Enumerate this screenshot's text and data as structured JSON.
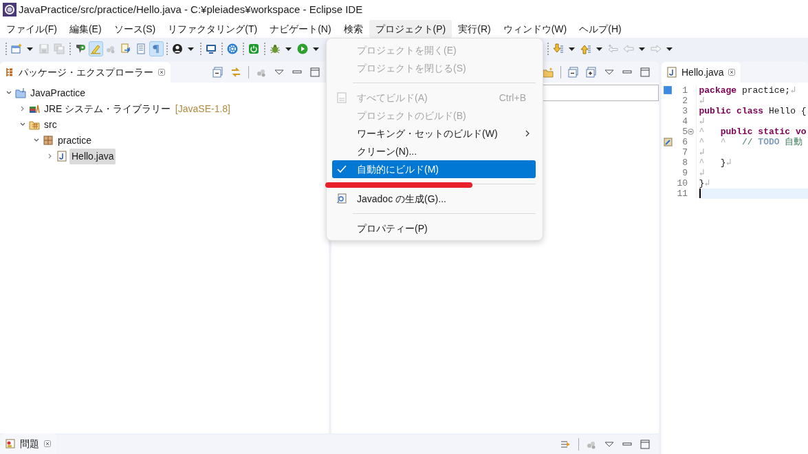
{
  "window": {
    "title": "JavaPractice/src/practice/Hello.java - C:¥pleiades¥workspace - Eclipse IDE"
  },
  "menubar": [
    {
      "label": "ファイル(F)",
      "selected": false
    },
    {
      "label": "編集(E)",
      "selected": false
    },
    {
      "label": "ソース(S)",
      "selected": false
    },
    {
      "label": "リファクタリング(T)",
      "selected": false
    },
    {
      "label": "ナビゲート(N)",
      "selected": false
    },
    {
      "label": "検索",
      "selected": false
    },
    {
      "label": "プロジェクト(P)",
      "selected": true
    },
    {
      "label": "実行(R)",
      "selected": false
    },
    {
      "label": "ウィンドウ(W)",
      "selected": false
    },
    {
      "label": "ヘルプ(H)",
      "selected": false
    }
  ],
  "toolbar_left": [
    [
      {
        "kind": "new",
        "dropdown": true,
        "pressed": false,
        "disabled": false
      },
      {
        "kind": "save",
        "dropdown": false,
        "pressed": false,
        "disabled": true
      },
      {
        "kind": "saveall",
        "dropdown": false,
        "pressed": false,
        "disabled": true
      }
    ],
    [
      {
        "kind": "opentype",
        "dropdown": false,
        "pressed": false,
        "disabled": false
      },
      {
        "kind": "highlight",
        "dropdown": false,
        "pressed": true,
        "disabled": false
      },
      {
        "kind": "beans",
        "dropdown": false,
        "pressed": false,
        "disabled": true
      },
      {
        "kind": "docarrow",
        "dropdown": false,
        "pressed": false,
        "disabled": false
      },
      {
        "kind": "doc",
        "dropdown": false,
        "pressed": false,
        "disabled": false
      },
      {
        "kind": "pilcrow",
        "dropdown": false,
        "pressed": true,
        "disabled": false
      }
    ],
    [
      {
        "kind": "user",
        "dropdown": true,
        "pressed": false,
        "disabled": false
      }
    ],
    [
      {
        "kind": "monitor",
        "dropdown": false,
        "pressed": false,
        "disabled": false
      }
    ],
    [
      {
        "kind": "gear",
        "dropdown": false,
        "pressed": false,
        "disabled": false
      }
    ],
    [
      {
        "kind": "power",
        "dropdown": false,
        "pressed": false,
        "disabled": false
      }
    ],
    [
      {
        "kind": "bug",
        "dropdown": true,
        "pressed": false,
        "disabled": false
      },
      {
        "kind": "run",
        "dropdown": true,
        "pressed": false,
        "disabled": false
      }
    ]
  ],
  "toolbar_right": [
    [
      {
        "kind": "nextann",
        "dropdown": true,
        "pressed": false,
        "disabled": false
      },
      {
        "kind": "prevann",
        "dropdown": true,
        "pressed": false,
        "disabled": false
      },
      {
        "kind": "lastedit",
        "dropdown": false,
        "pressed": false,
        "disabled": true
      },
      {
        "kind": "back",
        "dropdown": true,
        "pressed": false,
        "disabled": true
      },
      {
        "kind": "forward",
        "dropdown": true,
        "pressed": false,
        "disabled": true
      }
    ]
  ],
  "explorer": {
    "tab": "パッケージ・エクスプローラー",
    "tree": [
      {
        "label": "JavaPractice",
        "kind": "project",
        "expanded": true,
        "selected": false,
        "children": [
          {
            "label": "JRE システム・ライブラリー",
            "decoration": "[JavaSE-1.8]",
            "kind": "library",
            "expanded": false,
            "selected": false
          },
          {
            "label": "src",
            "kind": "srcfolder",
            "expanded": true,
            "selected": false,
            "children": [
              {
                "label": "practice",
                "kind": "package",
                "expanded": true,
                "selected": false,
                "children": [
                  {
                    "label": "Hello.java",
                    "kind": "javafile",
                    "expanded": false,
                    "selected": true
                  }
                ]
              }
            ]
          }
        ]
      }
    ]
  },
  "project_menu": [
    [
      {
        "label": "プロジェクトを開く(E)",
        "disabled": true,
        "checked": false,
        "selected": false,
        "submenu": false,
        "underlined": false
      },
      {
        "label": "プロジェクトを閉じる(S)",
        "disabled": true,
        "checked": false,
        "selected": false,
        "submenu": false,
        "underlined": false
      }
    ],
    [
      {
        "label": "すべてビルド(A)",
        "shortcut": "Ctrl+B",
        "disabled": true,
        "checked": false,
        "selected": false,
        "submenu": false,
        "underlined": false
      },
      {
        "label": "プロジェクトのビルド(B)",
        "disabled": true,
        "checked": false,
        "selected": false,
        "submenu": false,
        "underlined": false
      },
      {
        "label": "ワーキング・セットのビルド(W)",
        "disabled": false,
        "checked": false,
        "selected": false,
        "submenu": true,
        "underlined": false
      },
      {
        "label": "クリーン(N)...",
        "disabled": false,
        "checked": false,
        "selected": false,
        "submenu": false,
        "underlined": false
      },
      {
        "label": "自動的にビルド(M)",
        "disabled": false,
        "checked": true,
        "selected": true,
        "submenu": false,
        "underlined": true
      }
    ],
    [
      {
        "label": "Javadoc の生成(G)...",
        "disabled": false,
        "checked": false,
        "selected": false,
        "submenu": false,
        "underlined": false
      }
    ],
    [
      {
        "label": "プロパティー(P)",
        "disabled": false,
        "checked": false,
        "selected": false,
        "submenu": false,
        "underlined": false
      }
    ]
  ],
  "editor": {
    "tab": "Hello.java",
    "lines": [
      {
        "number": "1",
        "current": false,
        "tokens": [
          {
            "kind": "keyword",
            "text": "package"
          },
          {
            "kind": "plain",
            "text": " practice;"
          },
          {
            "kind": "ws",
            "text": "↲"
          }
        ]
      },
      {
        "number": "2",
        "current": false,
        "tokens": [
          {
            "kind": "ws",
            "text": "↲"
          }
        ]
      },
      {
        "number": "3",
        "current": false,
        "tokens": [
          {
            "kind": "keyword",
            "text": "public class"
          },
          {
            "kind": "plain",
            "text": " Hello {"
          }
        ]
      },
      {
        "number": "4",
        "current": false,
        "tokens": [
          {
            "kind": "ws",
            "text": "↲"
          }
        ]
      },
      {
        "number": "5",
        "current": false,
        "tokens": [
          {
            "kind": "ws",
            "text": "^   "
          },
          {
            "kind": "keyword",
            "text": "public static vo"
          }
        ]
      },
      {
        "number": "6",
        "current": false,
        "tokens": [
          {
            "kind": "ws",
            "text": "^   ^   "
          },
          {
            "kind": "comment",
            "text": "// "
          },
          {
            "kind": "todo",
            "text": "TODO"
          },
          {
            "kind": "comment",
            "text": " 自動"
          }
        ]
      },
      {
        "number": "7",
        "current": false,
        "tokens": [
          {
            "kind": "ws",
            "text": "↲"
          }
        ]
      },
      {
        "number": "8",
        "current": false,
        "tokens": [
          {
            "kind": "ws",
            "text": "^   "
          },
          {
            "kind": "plain",
            "text": "}"
          },
          {
            "kind": "ws",
            "text": "↲"
          }
        ]
      },
      {
        "number": "9",
        "current": false,
        "tokens": [
          {
            "kind": "ws",
            "text": "↲"
          }
        ]
      },
      {
        "number": "10",
        "current": false,
        "tokens": [
          {
            "kind": "plain",
            "text": "}"
          },
          {
            "kind": "ws",
            "text": "↲"
          }
        ]
      },
      {
        "number": "11",
        "current": true
      }
    ]
  },
  "problems": {
    "tab": "問題"
  }
}
